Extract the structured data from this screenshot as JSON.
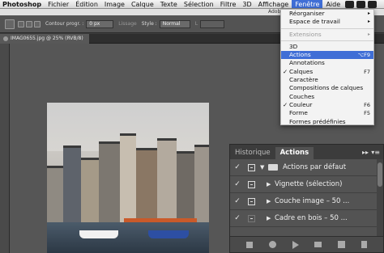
{
  "menubar": {
    "app": "Photoshop",
    "items": [
      "Fichier",
      "Édition",
      "Image",
      "Calque",
      "Texte",
      "Sélection",
      "Filtre",
      "3D",
      "Affichage",
      "Fenêtre",
      "Aide"
    ],
    "active_index": 9
  },
  "window_title": "Adobe Pho",
  "options": {
    "contour_label": "Contour progr. :",
    "contour_value": "0 px",
    "lissage_label": "Lissage",
    "style_label": "Style :",
    "style_value": "Normal",
    "l_label": "L"
  },
  "document_tab": "IMAG0655.jpg @ 25% (RVB/8)",
  "window_menu": {
    "rows": [
      {
        "label": "Réorganiser",
        "arrow": "▸"
      },
      {
        "label": "Espace de travail",
        "arrow": "▸"
      },
      {
        "label": "Extensions",
        "disabled": true,
        "arrow": "▸"
      },
      {
        "label": "3D"
      },
      {
        "label": "Actions",
        "shortcut": "⌥F9",
        "selected": true
      },
      {
        "label": "Annotations"
      },
      {
        "label": "Calques",
        "check": "✓",
        "shortcut": "F7"
      },
      {
        "label": "Caractère"
      },
      {
        "label": "Compositions de calques"
      },
      {
        "label": "Couches"
      },
      {
        "label": "Couleur",
        "check": "✓",
        "shortcut": "F6"
      },
      {
        "label": "Forme",
        "shortcut": "F5"
      },
      {
        "label": "Formes prédéfinies"
      }
    ]
  },
  "panel": {
    "tabs": [
      "Historique",
      "Actions"
    ],
    "active_tab": 1,
    "actions": [
      {
        "label": "Actions par défaut",
        "type": "set"
      },
      {
        "label": "Vignette (sélection)",
        "type": "action"
      },
      {
        "label": "Couche image – 50 ...",
        "type": "action"
      },
      {
        "label": "Cadre en bois – 50 ...",
        "type": "action"
      }
    ]
  },
  "colors": {
    "menu_highlight": "#3f6ed6",
    "panel_bg": "#535353"
  }
}
